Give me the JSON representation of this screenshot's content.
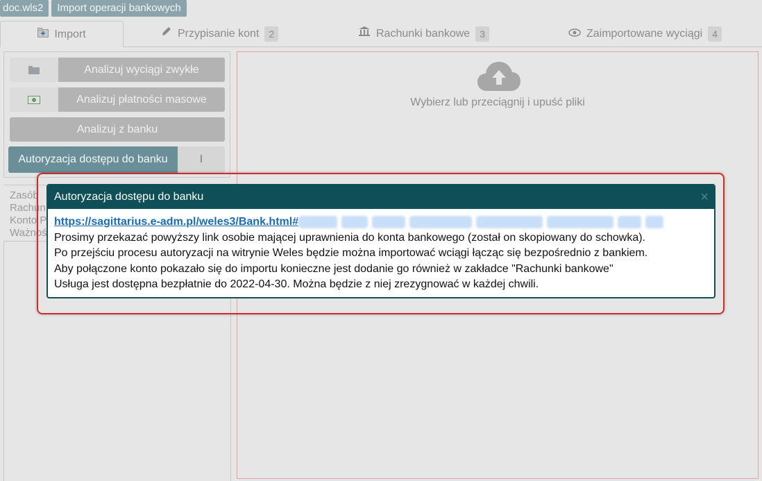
{
  "breadcrumb": {
    "file": "doc.wls2",
    "module": "Import operacji bankowych"
  },
  "tabs": [
    {
      "label": "Import",
      "icon": "import-icon",
      "count": null
    },
    {
      "label": "Przypisanie kont",
      "icon": "pencil-icon",
      "count": "2"
    },
    {
      "label": "Rachunki bankowe",
      "icon": "bank-icon",
      "count": "3"
    },
    {
      "label": "Zaimportowane wyciągi",
      "icon": "eye-icon",
      "count": "4"
    }
  ],
  "left_panel": {
    "btn_statements": "Analizuj wyciągi zwykłe",
    "btn_mass_payments": "Analizuj płatności masowe",
    "btn_from_bank": "Analizuj z banku",
    "btn_auth": "Autoryzacja dostępu do banku",
    "btn_auth_side": "I"
  },
  "left_list": {
    "line1": "Zasób",
    "line2": "Rachun",
    "line3": "Konto P",
    "line4": "Ważnoś"
  },
  "dropzone": {
    "text": "Wybierz lub przeciągnij i upuść pliki"
  },
  "modal": {
    "title": "Autoryzacja dostępu do banku",
    "close": "×",
    "link": "https://sagittarius.e-adm.pl/weles3/Bank.html#",
    "line1": "Prosimy przekazać powyższy link osobie mającej uprawnienia do konta bankowego (został on skopiowany do schowka).",
    "line2": "Po przejściu procesu autoryzacji na witrynie Weles będzie można importować wciągi łącząc się bezpośrednio z bankiem.",
    "line3": "Aby połączone konto pokazało się do importu konieczne jest dodanie go również w zakładce \"Rachunki bankowe\"",
    "line4": "Usługa jest dostępna bezpłatnie do 2022-04-30. Można będzie z niej zrezygnować w każdej chwili."
  },
  "colors": {
    "modal_header": "#0f4f57",
    "highlight": "#d02a2a",
    "link": "#1a6db5",
    "auth_button": "#6a8f98"
  }
}
